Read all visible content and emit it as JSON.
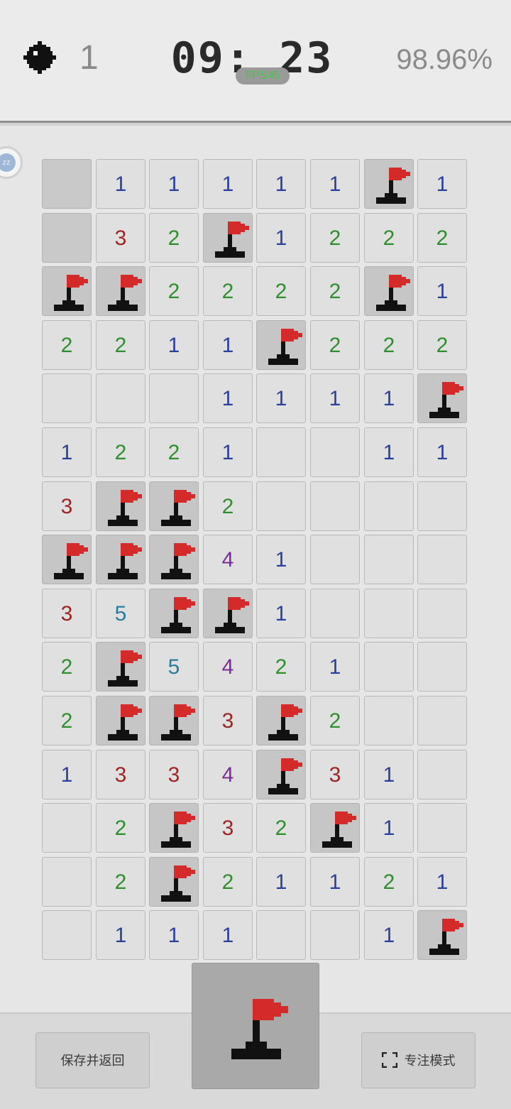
{
  "header": {
    "mines_remaining": "1",
    "timer": "09: 23",
    "fps_label": "FPS45",
    "progress_percent": "98.96%",
    "side_badge_text": "zz"
  },
  "board": {
    "rows": 15,
    "cols": 8,
    "grid": [
      [
        "H",
        "1",
        "1",
        "1",
        "1",
        "1",
        "F",
        "1"
      ],
      [
        "H",
        "3",
        "2",
        "F",
        "1",
        "2",
        "2",
        "2"
      ],
      [
        "F",
        "F",
        "2",
        "2",
        "2",
        "2",
        "F",
        "1"
      ],
      [
        "2",
        "2",
        "1",
        "1",
        "F",
        "2",
        "2",
        "2"
      ],
      [
        "",
        "",
        "",
        "1",
        "1",
        "1",
        "1",
        "F"
      ],
      [
        "1",
        "2",
        "2",
        "1",
        "",
        "",
        "1",
        "1"
      ],
      [
        "3",
        "F",
        "F",
        "2",
        "",
        "",
        "",
        ""
      ],
      [
        "F",
        "F",
        "F",
        "4",
        "1",
        "",
        "",
        ""
      ],
      [
        "3",
        "5",
        "F",
        "F",
        "1",
        "",
        "",
        ""
      ],
      [
        "2",
        "F",
        "5",
        "4",
        "2",
        "1",
        "",
        ""
      ],
      [
        "2",
        "F",
        "F",
        "3",
        "F",
        "2",
        "",
        ""
      ],
      [
        "1",
        "3",
        "3",
        "4",
        "F",
        "3",
        "1",
        ""
      ],
      [
        "",
        "2",
        "F",
        "3",
        "2",
        "F",
        "1",
        ""
      ],
      [
        "",
        "2",
        "F",
        "2",
        "1",
        "1",
        "2",
        "1"
      ],
      [
        "",
        "1",
        "1",
        "1",
        "",
        "",
        "1",
        "F"
      ]
    ],
    "legend": {
      "H": "unrevealed",
      "F": "flag",
      "": "revealed-empty"
    }
  },
  "controls": {
    "save_label": "保存并返回",
    "focus_label": "专注模式",
    "mode_icon": "flag-icon"
  },
  "colors": {
    "n1": "#2b3f9c",
    "n2": "#2f8f2f",
    "n3": "#9e2424",
    "n4": "#7a2a9a",
    "n5": "#2a7d9a",
    "flag": "#d42a2a",
    "fps": "#49c44b"
  }
}
